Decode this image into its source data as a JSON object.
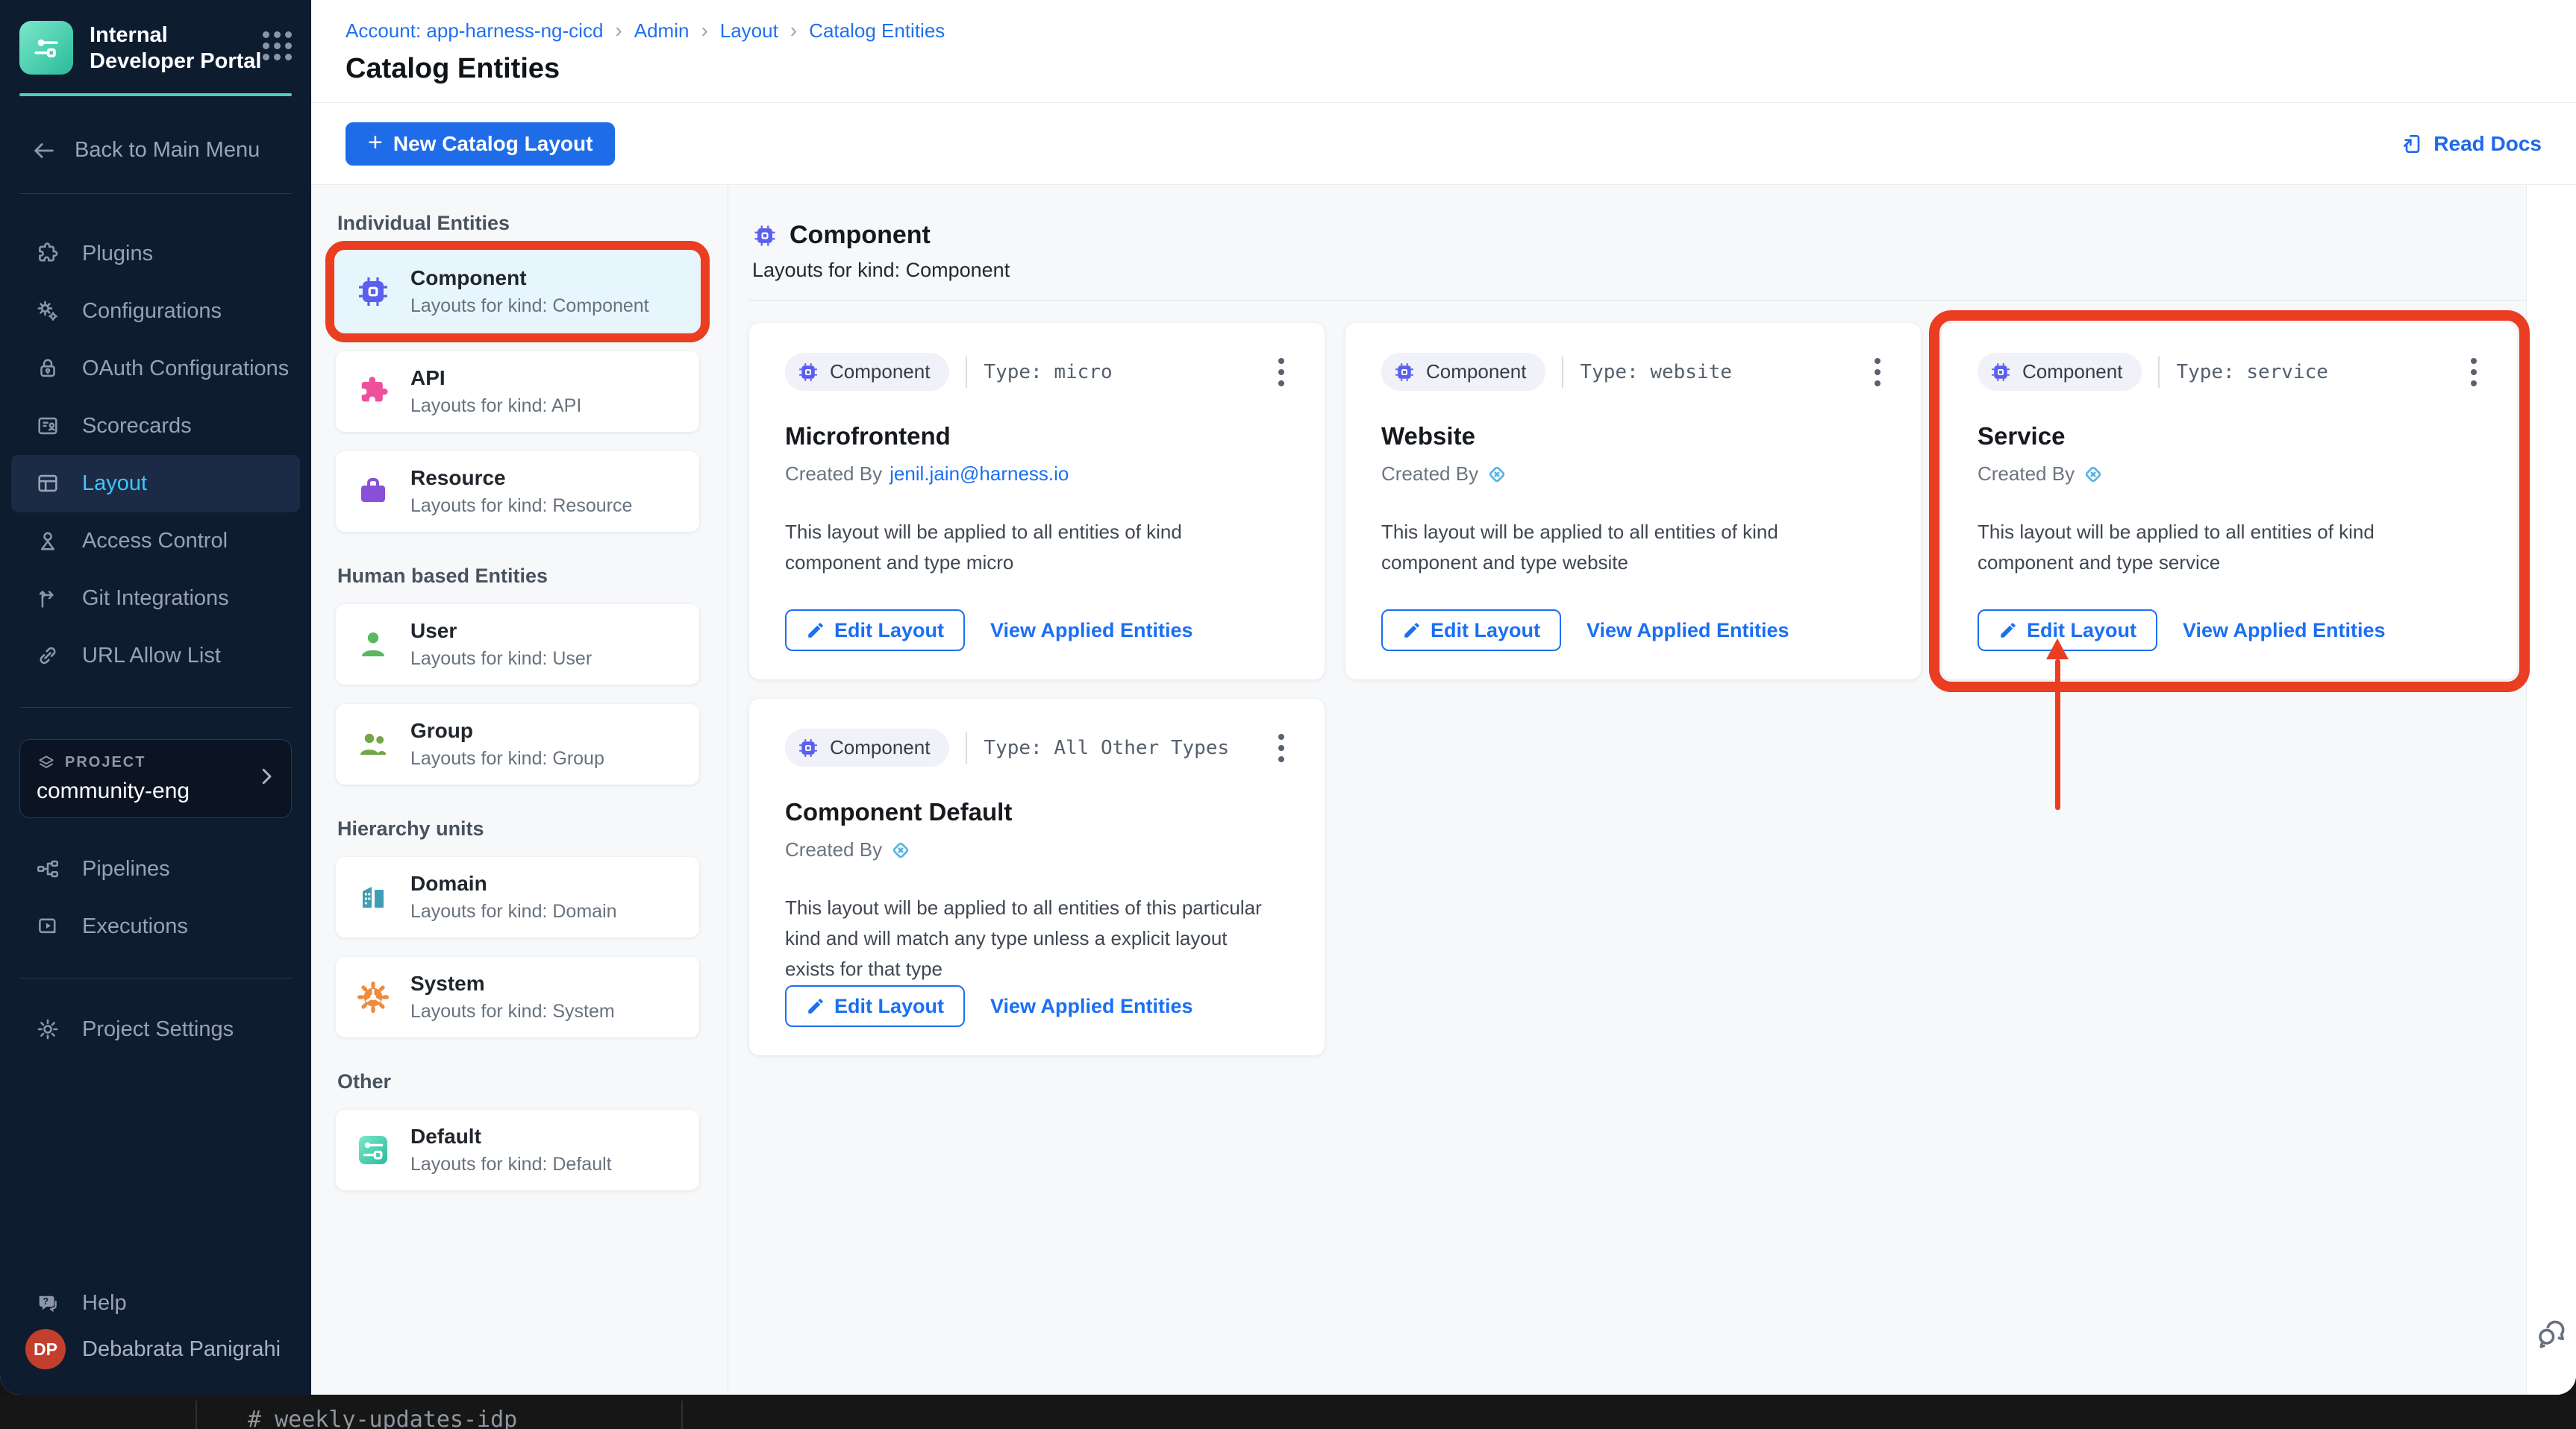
{
  "window": {
    "bottom_bar": {
      "channel": "#  weekly-updates-idp"
    }
  },
  "sidebar": {
    "app_title": "Internal Developer Portal",
    "back_label": "Back to Main Menu",
    "nav": [
      {
        "label": "Plugins",
        "icon": "puzzle-icon"
      },
      {
        "label": "Configurations",
        "icon": "gears-icon"
      },
      {
        "label": "OAuth Configurations",
        "icon": "lock-icon"
      },
      {
        "label": "Scorecards",
        "icon": "scorecard-icon"
      },
      {
        "label": "Layout",
        "icon": "layout-icon",
        "active": true
      },
      {
        "label": "Access Control",
        "icon": "person-icon"
      },
      {
        "label": "Git Integrations",
        "icon": "git-branch-icon"
      },
      {
        "label": "URL Allow List",
        "icon": "link-icon"
      }
    ],
    "project": {
      "eyebrow": "PROJECT",
      "name": "community-eng"
    },
    "project_nav": [
      {
        "label": "Pipelines",
        "icon": "pipeline-icon"
      },
      {
        "label": "Executions",
        "icon": "play-icon"
      }
    ],
    "settings_label": "Project Settings",
    "help_label": "Help",
    "user": {
      "initials": "DP",
      "name": "Debabrata Panigrahi"
    }
  },
  "header": {
    "breadcrumb": [
      "Account: app-harness-ng-cicd",
      "Admin",
      "Layout",
      "Catalog Entities"
    ],
    "title": "Catalog Entities"
  },
  "toolbar": {
    "new_button": "New Catalog Layout",
    "read_docs": "Read Docs"
  },
  "entity_panel": {
    "sections": [
      {
        "heading": "Individual Entities",
        "items": [
          {
            "name": "Component",
            "subtitle": "Layouts for kind: Component",
            "icon": "chip-icon",
            "selected": true,
            "annotated": true
          },
          {
            "name": "API",
            "subtitle": "Layouts for kind: API",
            "icon": "puzzle-piece-icon"
          },
          {
            "name": "Resource",
            "subtitle": "Layouts for kind: Resource",
            "icon": "briefcase-icon"
          }
        ]
      },
      {
        "heading": "Human based Entities",
        "items": [
          {
            "name": "User",
            "subtitle": "Layouts for kind: User",
            "icon": "user-icon"
          },
          {
            "name": "Group",
            "subtitle": "Layouts for kind: Group",
            "icon": "group-icon"
          }
        ]
      },
      {
        "heading": "Hierarchy units",
        "items": [
          {
            "name": "Domain",
            "subtitle": "Layouts for kind: Domain",
            "icon": "building-icon"
          },
          {
            "name": "System",
            "subtitle": "Layouts for kind: System",
            "icon": "gear-icon"
          }
        ]
      },
      {
        "heading": "Other",
        "items": [
          {
            "name": "Default",
            "subtitle": "Layouts for kind: Default",
            "icon": "idp-logo-icon"
          }
        ]
      }
    ]
  },
  "main": {
    "heading": "Component",
    "subheading": "Layouts for kind: Component",
    "cards": [
      {
        "badge": "Component",
        "type_label": "Type: micro",
        "title": "Microfrontend",
        "created_prefix": "Created By",
        "created_link": "jenil.jain@harness.io",
        "description": "This layout will be applied to all entities of kind component and type micro",
        "edit_label": "Edit Layout",
        "view_label": "View Applied Entities"
      },
      {
        "badge": "Component",
        "type_label": "Type: website",
        "title": "Website",
        "created_prefix": "Created By",
        "description": "This layout will be applied to all entities of kind component and type website",
        "edit_label": "Edit Layout",
        "view_label": "View Applied Entities"
      },
      {
        "badge": "Component",
        "type_label": "Type: service",
        "title": "Service",
        "created_prefix": "Created By",
        "description": "This layout will be applied to all entities of kind component and type service",
        "edit_label": "Edit Layout",
        "view_label": "View Applied Entities"
      },
      {
        "badge": "Component",
        "type_label": "Type: All Other Types",
        "title": "Component Default",
        "created_prefix": "Created By",
        "description": "This layout will be applied to all entities of this particular kind and will match any type unless a explicit layout exists for that type",
        "edit_label": "Edit Layout",
        "view_label": "View Applied Entities"
      }
    ]
  },
  "colors": {
    "accent_blue": "#1f6ce8",
    "sidebar_bg": "#0e1c30",
    "active_link": "#41c4ff",
    "teal": "#4ed0b5",
    "annotation_red": "#ea3d22",
    "chip_indigo": "#5a5ff0"
  }
}
